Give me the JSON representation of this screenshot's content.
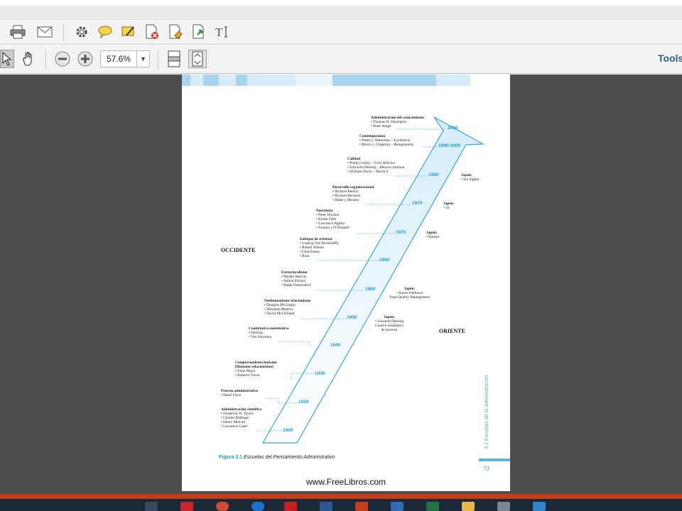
{
  "app": {
    "zoom": "57.6%",
    "tools_label": "Tools"
  },
  "document": {
    "region_west": "OCCIDENTE",
    "region_east": "ORIENTE",
    "figure_number": "Figura 3.1",
    "figure_title": "Escuelas del Pensamiento Administrativo",
    "side_label": "3.1  Escuelas de la administración",
    "page_number": "73",
    "watermark": "www.FreeLibros.com",
    "schools": [
      {
        "title": "Administración del conocimiento",
        "items": [
          "• Thomas H. Davenport",
          "• Peter Senge"
        ],
        "year": "2000"
      },
      {
        "title": "Contemporánea",
        "items": [
          "• Peters y Waterman – Excelencia",
          "• Morris y Chapman – Reingeniería"
        ],
        "year": "1990-2000"
      },
      {
        "title": "Calidad",
        "items": [
          "• Philip Crosby – Cero defectos",
          "• Edwards Deming – Mejora continua",
          "• William Ouchi – Teoría Z"
        ],
        "year": "1980"
      },
      {
        "title": "Desarrollo organizacional",
        "items": [
          "• Richard Bennis",
          "• Richard Beckard",
          "• Blake y Mouton"
        ],
        "year": "1970"
      },
      {
        "title": "Neoclásico",
        "items": [
          "• Peter Drucker",
          "• Ernest Dale",
          "• Lawrence Appley",
          "• Koontz y O’Donnell"
        ],
        "year": "1970"
      },
      {
        "title": "Enfoque de sistemas",
        "items": [
          "• Ludwig Von Bertalanffy",
          "• Robert Wiener",
          "• Churchman",
          "• Ross"
        ],
        "year": "1960"
      },
      {
        "title": "Estructuralismo",
        "items": [
          "• Renate Mayntz",
          "• Amitai Etzioni",
          "• Ralph Dahrendorf"
        ],
        "year": "1960"
      },
      {
        "title": "Neohumanismo relacionismo",
        "items": [
          "• Douglas McGregor",
          "• Abraham Maslow",
          "• David McClelland"
        ],
        "year": "1950"
      },
      {
        "title": "Cuantitativa matemática",
        "items": [
          "• Dantzig",
          "• Von Newman"
        ],
        "year": "1940"
      },
      {
        "title": "Comportamiento humano",
        "items": [
          "(Humano-relacionismo)",
          "• Elton Mayo",
          "• Roberto Owen"
        ],
        "year": "1930"
      },
      {
        "title": "Proceso administrativo",
        "items": [
          "• Henri Fayol"
        ],
        "year": "1920"
      },
      {
        "title": "Administración científica",
        "items": [
          "• Frederick W. Taylor",
          "• Charles Babbage",
          "• Henry Metcalf",
          "• Lawrence Gantt"
        ],
        "year": "1900"
      }
    ],
    "japan": [
      {
        "title": "Japón:",
        "items": [
          "• Six Sigma"
        ]
      },
      {
        "title": "Japón:",
        "items": [
          "• 5S"
        ]
      },
      {
        "title": "Japón:",
        "items": [
          "• Kaizen"
        ]
      },
      {
        "title": "Japón:",
        "items": [
          "• Kaoru Ishikawa",
          "Total Quality Management"
        ]
      },
      {
        "title": "Japón:",
        "items": [
          "• Edwards Deming",
          "Control estadístico",
          "de proceso"
        ]
      }
    ]
  },
  "icons": {
    "toolbar1": [
      "print-icon",
      "email-icon",
      "gear-icon",
      "comment-icon",
      "highlight-icon",
      "delete-page-icon",
      "export-icon",
      "share-icon",
      "text-select-icon"
    ],
    "toolbar2": [
      "select-arrow-icon",
      "hand-icon",
      "zoom-out-icon",
      "zoom-in-icon",
      "fit-page-icon",
      "fit-width-icon"
    ]
  },
  "colors": {
    "accent": "#1f9bd6",
    "viewer_bg": "#4d4d4d",
    "taskbar": "#1b2838",
    "strip": "#c53e1a"
  }
}
